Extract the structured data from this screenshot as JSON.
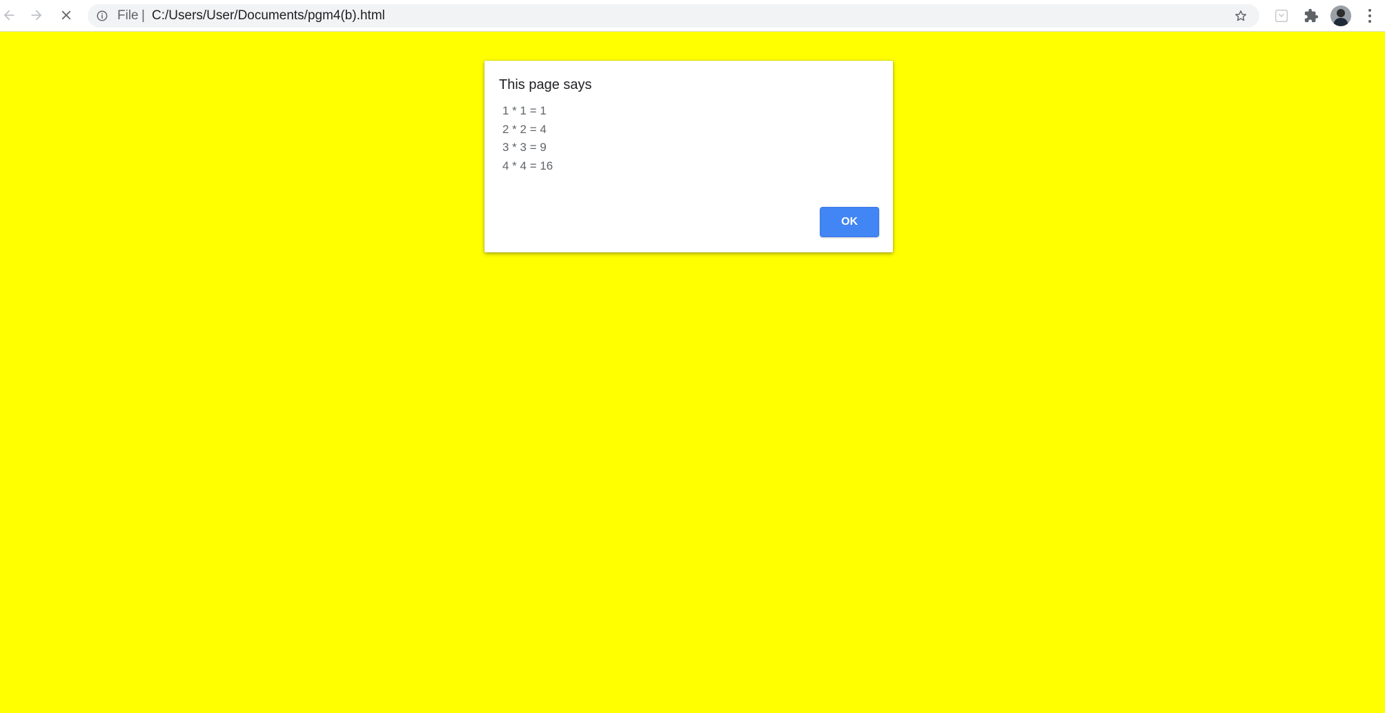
{
  "browser": {
    "scheme_label": "File",
    "scheme_separator": "|",
    "url": "C:/Users/User/Documents/pgm4(b).html",
    "icons": {
      "back": "arrow-left-icon",
      "forward": "arrow-right-icon",
      "stop": "close-icon",
      "info": "info-icon",
      "bookmark": "star-icon",
      "extension_box": "extension-box-icon",
      "extensions": "puzzle-icon",
      "profile": "avatar",
      "menu": "kebab-menu-icon"
    }
  },
  "page": {
    "background_color": "#ffff00"
  },
  "dialog": {
    "title": "This page says",
    "lines": [
      "1 * 1 = 1",
      "2 * 2 = 4",
      "3 * 3 = 9",
      "4 * 4 = 16"
    ],
    "ok_label": "OK",
    "button_color": "#4285f4"
  }
}
